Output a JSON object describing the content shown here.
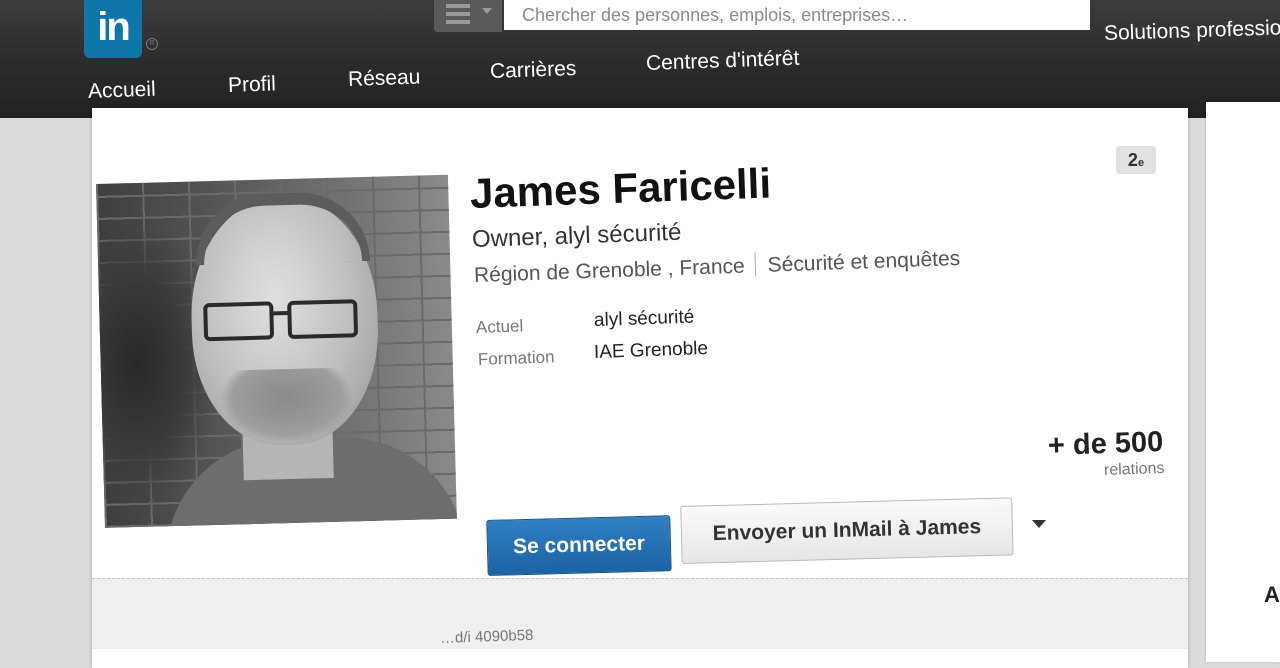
{
  "header": {
    "logo_text": "in",
    "search_placeholder": "Chercher des personnes, emplois, entreprises…",
    "solutions_label": "Solutions professionnelles"
  },
  "nav": {
    "items": [
      "Accueil",
      "Profil",
      "Réseau",
      "Carrières",
      "Centres d'intérêt"
    ]
  },
  "profile": {
    "name": "James Faricelli",
    "headline": "Owner, alyl sécurité",
    "location": "Région de Grenoble , France",
    "industry": "Sécurité et enquêtes",
    "degree": "2",
    "degree_suffix": "e",
    "details": [
      {
        "label": "Actuel",
        "value": "alyl sécurité"
      },
      {
        "label": "Formation",
        "value": "IAE Grenoble"
      }
    ],
    "connections_count": "+ de 500",
    "connections_label": "relations",
    "connect_button": "Se connecter",
    "inmail_button": "Envoyer un InMail à James",
    "footer_text": "…d/i 4090b58"
  },
  "side_panel": {
    "partial_text": "A"
  },
  "colors": {
    "brand_blue": "#0e76a8",
    "primary_button": "#1c63a3",
    "topbar": "#2b2b2b"
  }
}
